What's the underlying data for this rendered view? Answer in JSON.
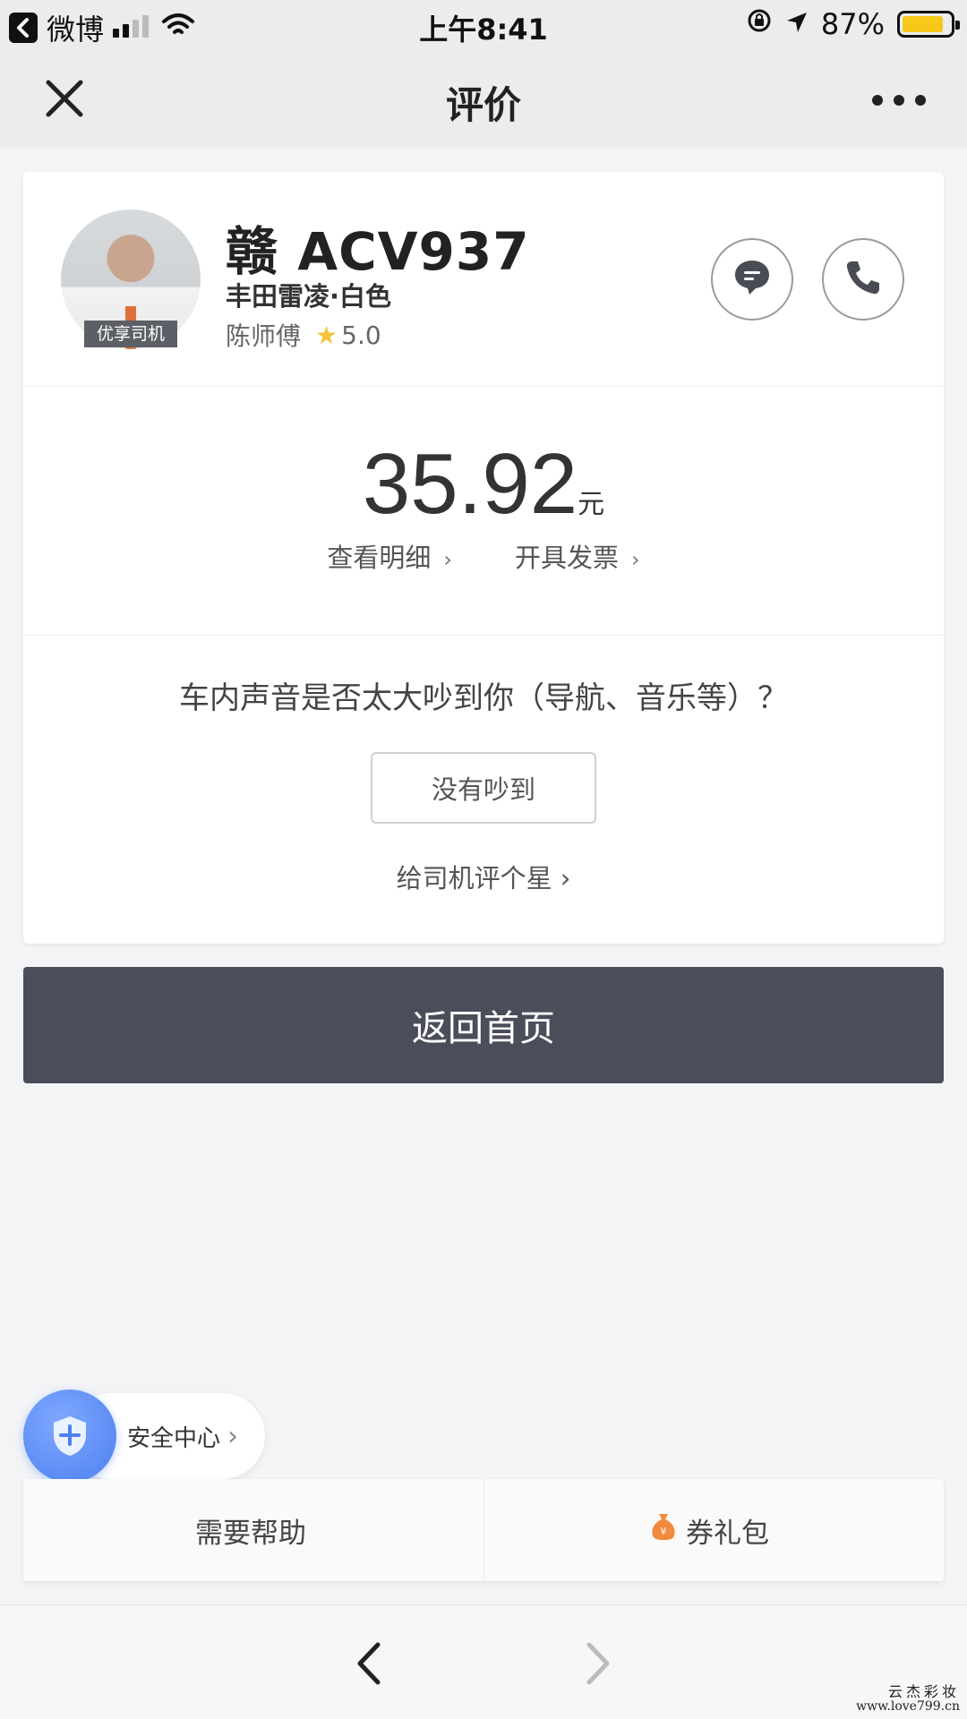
{
  "status_bar": {
    "back_app": "微博",
    "time": "上午8:41",
    "battery": "87%",
    "battery_level": 0.87
  },
  "nav": {
    "title": "评价"
  },
  "driver": {
    "badge": "优享司机",
    "plate": "赣 ACV937",
    "car": "丰田雷凌·白色",
    "name": "陈师傅",
    "rating": "5.0"
  },
  "fare": {
    "amount": "35.92",
    "unit": "元",
    "detail_link": "查看明细",
    "invoice_link": "开具发票"
  },
  "survey": {
    "question": "车内声音是否太大吵到你（导航、音乐等）？",
    "answer_button": "没有吵到",
    "rate_link": "给司机评个星 ›"
  },
  "home_button": "返回首页",
  "safety": {
    "label": "安全中心"
  },
  "bottom": {
    "help": "需要帮助",
    "coupon": "券礼包"
  },
  "watermark": {
    "line1": "云杰彩妆",
    "line2": "www.love799.cn"
  },
  "colors": {
    "primary_button": "#4b4d5b",
    "star": "#f7c33b",
    "safety_blue": "#4c7ff0",
    "battery": "#f7c71a"
  }
}
